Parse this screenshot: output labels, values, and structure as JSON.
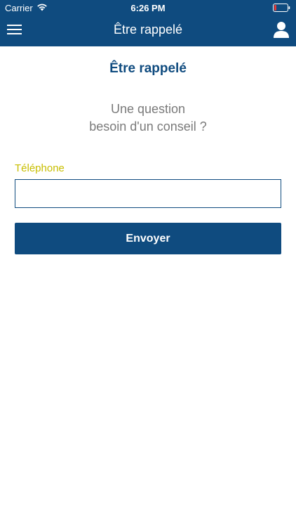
{
  "status_bar": {
    "carrier": "Carrier",
    "time": "6:26 PM"
  },
  "nav": {
    "title": "Être rappelé",
    "menu_icon": "hamburger-menu-icon",
    "user_icon": "user-icon"
  },
  "main": {
    "title": "Être rappelé",
    "intro_line1": "Une question",
    "intro_line2": "besoin d'un conseil ?",
    "phone_label": "Téléphone",
    "phone_value": "",
    "send_label": "Envoyer"
  },
  "colors": {
    "brand_blue": "#0f4b7f",
    "label_yellow": "#c8be00",
    "intro_gray": "#7a7a7a",
    "battery_low": "#e53935"
  }
}
